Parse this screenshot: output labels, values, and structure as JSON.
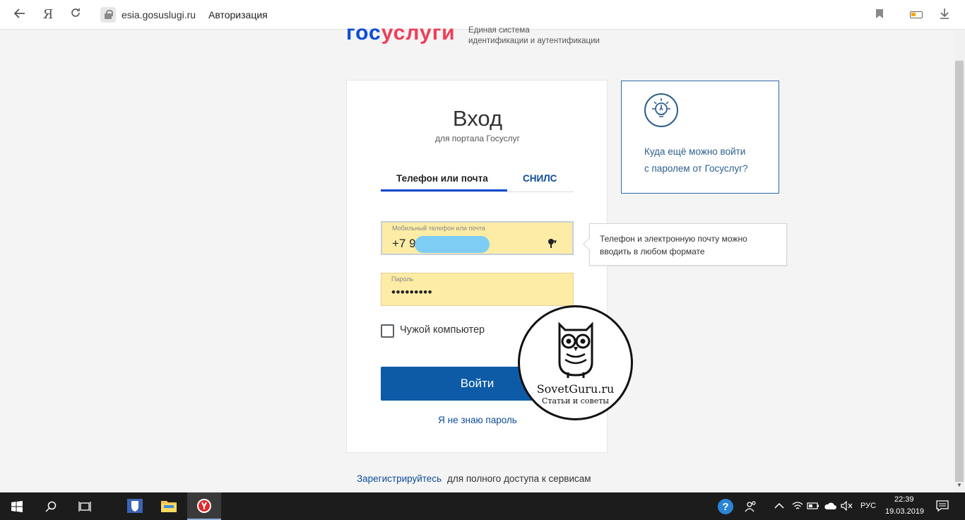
{
  "browser": {
    "back_icon": "back-arrow-icon",
    "yandex_icon": "yandex-logo-icon",
    "yandex_glyph": "Я",
    "reload_icon": "reload-icon",
    "domain": "esia.gosuslugi.ru",
    "page_title": "Авторизация"
  },
  "header": {
    "logo_part1": "гос",
    "logo_part2": "услуги",
    "subtitle_line1": "Единая система",
    "subtitle_line2": "идентификации и аутентификации"
  },
  "login": {
    "title": "Вход",
    "subtitle": "для портала Госуслуг",
    "tabs": [
      {
        "label": "Телефон или почта",
        "active": true
      },
      {
        "label": "СНИЛС",
        "active": false
      }
    ],
    "phone_label": "Мобильный телефон или почта",
    "phone_value": "+7 9",
    "password_label": "Пароль",
    "password_value": "•••••••••",
    "checkbox_label": "Чужой компьютер",
    "login_button": "Войти",
    "forgot_link": "Я не знаю пароль"
  },
  "tooltip": {
    "line1": "Телефон и электронную почту можно",
    "line2": "вводить в любом формате"
  },
  "info_card": {
    "icon": "lightbulb-icon",
    "line1": "Куда ещё можно войти",
    "line2": "с паролем от Госуслуг?"
  },
  "register": {
    "link": "Зарегистрируйтесь",
    "rest": "для полного доступа к сервисам"
  },
  "watermark": {
    "title": "SovetGuru.ru",
    "subtitle": "Статьи и советы"
  },
  "taskbar": {
    "lang": "РУС",
    "time": "22:39",
    "date": "19.03.2019"
  },
  "colors": {
    "brand_blue": "#0d4cd3",
    "brand_red": "#ee3f58",
    "button_blue": "#0d5aa7",
    "field_yellow": "#fdeca6"
  }
}
